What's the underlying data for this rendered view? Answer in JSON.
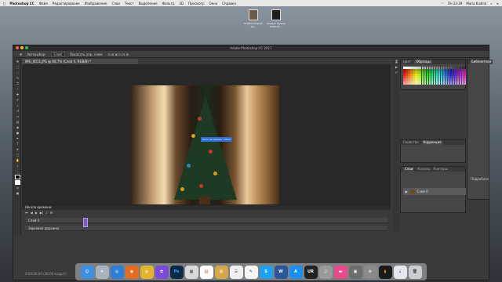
{
  "menubar": {
    "app": "Photoshop CC",
    "items": [
      "Файл",
      "Редактирование",
      "Изображение",
      "Слои",
      "Текст",
      "Выделение",
      "Фильтр",
      "3D",
      "Просмотр",
      "Окно",
      "Справка"
    ],
    "clock": "Пн 23:29",
    "user": "Maria Kudina"
  },
  "desktop": {
    "icons": [
      {
        "label": "Untitled_Export-Ap..."
      },
      {
        "label": "Снимок экрана 2018-12-..."
      }
    ]
  },
  "window": {
    "title": "Adobe Photoshop CC 2017",
    "options": {
      "tool_label": "Автовыбор:",
      "tool_value": "Слой",
      "transform_label": "Показать упр. элем."
    },
    "doc_tab": "IMG_0011.JPG @ 66,7% (Слой 0, RGB/8) *",
    "canvas_tag": "Фото на память / 2019"
  },
  "panels": {
    "color_tabs": {
      "tab1": "Цвет",
      "tab2": "Образцы"
    },
    "learn_tab": "Библиотеки",
    "properties_tabs": {
      "tab1": "Свойства",
      "tab2": "Коррекция"
    },
    "layers_tabs": {
      "tab1": "Слои",
      "tab2": "Каналы",
      "tab3": "Контуры"
    },
    "layers": [
      {
        "name": "Слой 0"
      }
    ],
    "cc_hint": "Подробнее"
  },
  "timeline": {
    "title": "Шкала времени",
    "tracks": [
      {
        "name": "Слой 0"
      },
      {
        "name": "Звуковая дорожка"
      }
    ],
    "timecode": "0:00:00:00",
    "fps": "(30,00 кадр/с)"
  },
  "dock": {
    "icons": [
      "finder-icon",
      "launchpad-icon",
      "safari-icon",
      "firefox-icon",
      "chrome-icon",
      "photos-icon",
      "photoshop-icon",
      "preview-icon",
      "calendar-icon",
      "notes-icon",
      "reminders-icon",
      "textedit-icon",
      "skype-icon",
      "word-icon",
      "appstore-icon",
      "ur-icon",
      "music-icon",
      "books-icon",
      "gallery-icon",
      "settings-icon",
      "terminal-icon",
      "downloads-icon",
      "trash-icon"
    ],
    "labels": {
      "photoshop": "Ps",
      "skype": "S",
      "word": "W",
      "ur": "UR"
    }
  },
  "colors": {
    "accent_blue": "#2b6fd6",
    "clip_purple": "#7d5bbf",
    "window_bg": "#3a3a3a"
  }
}
